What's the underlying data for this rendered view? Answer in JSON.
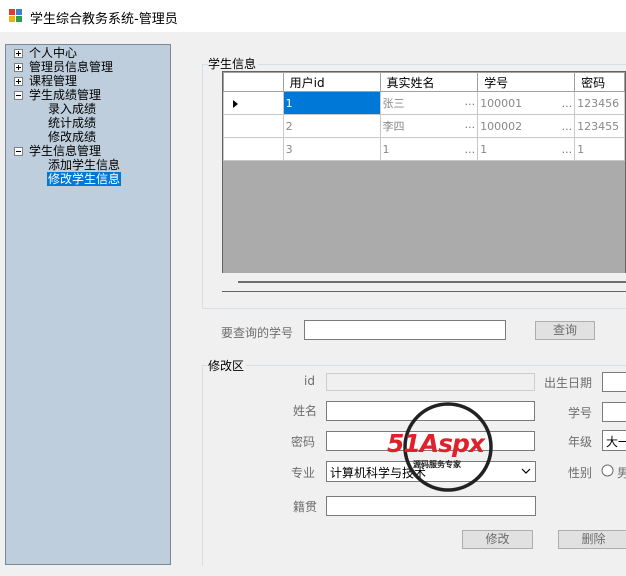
{
  "window": {
    "title": "学生综合教务系统-管理员"
  },
  "tree": {
    "personal_center": "个人中心",
    "admin_info": "管理员信息管理",
    "course_mgmt": "课程管理",
    "score_mgmt": "学生成绩管理",
    "score_enter": "录入成绩",
    "score_stats": "统计成绩",
    "score_edit": "修改成绩",
    "student_info_mgmt": "学生信息管理",
    "add_student": "添加学生信息",
    "edit_student": "修改学生信息"
  },
  "student_info": {
    "group_title": "学生信息",
    "columns": [
      "用户id",
      "真实姓名",
      "学号",
      "密码"
    ],
    "rows": [
      [
        "1",
        "张三",
        "100001",
        "123456"
      ],
      [
        "2",
        "李四",
        "100002",
        "123455"
      ],
      [
        "3",
        "1",
        "1",
        "1"
      ]
    ],
    "ellipsis": "..."
  },
  "search": {
    "label": "要查询的学号",
    "value": "",
    "button": "查询"
  },
  "edit": {
    "group_title": "修改区",
    "id_label": "id",
    "name_label": "姓名",
    "password_label": "密码",
    "major_label": "专业",
    "major_value": "计算机科学与技术",
    "hometown_label": "籍贯",
    "birth_label": "出生日期",
    "stuno_label": "学号",
    "grade_label": "年级",
    "grade_value": "大一",
    "gender_label": "性别",
    "gender_option": "男",
    "modify_button": "修改",
    "delete_button": "删除"
  },
  "watermark": {
    "brand": "51Aspx",
    "sub": "源码服务专家"
  },
  "colors": {
    "tree_bg": "#bfcedc",
    "selection": "#0078d7",
    "watermark_red": "#e0202a",
    "watermark_green": "#3a9a3a"
  }
}
